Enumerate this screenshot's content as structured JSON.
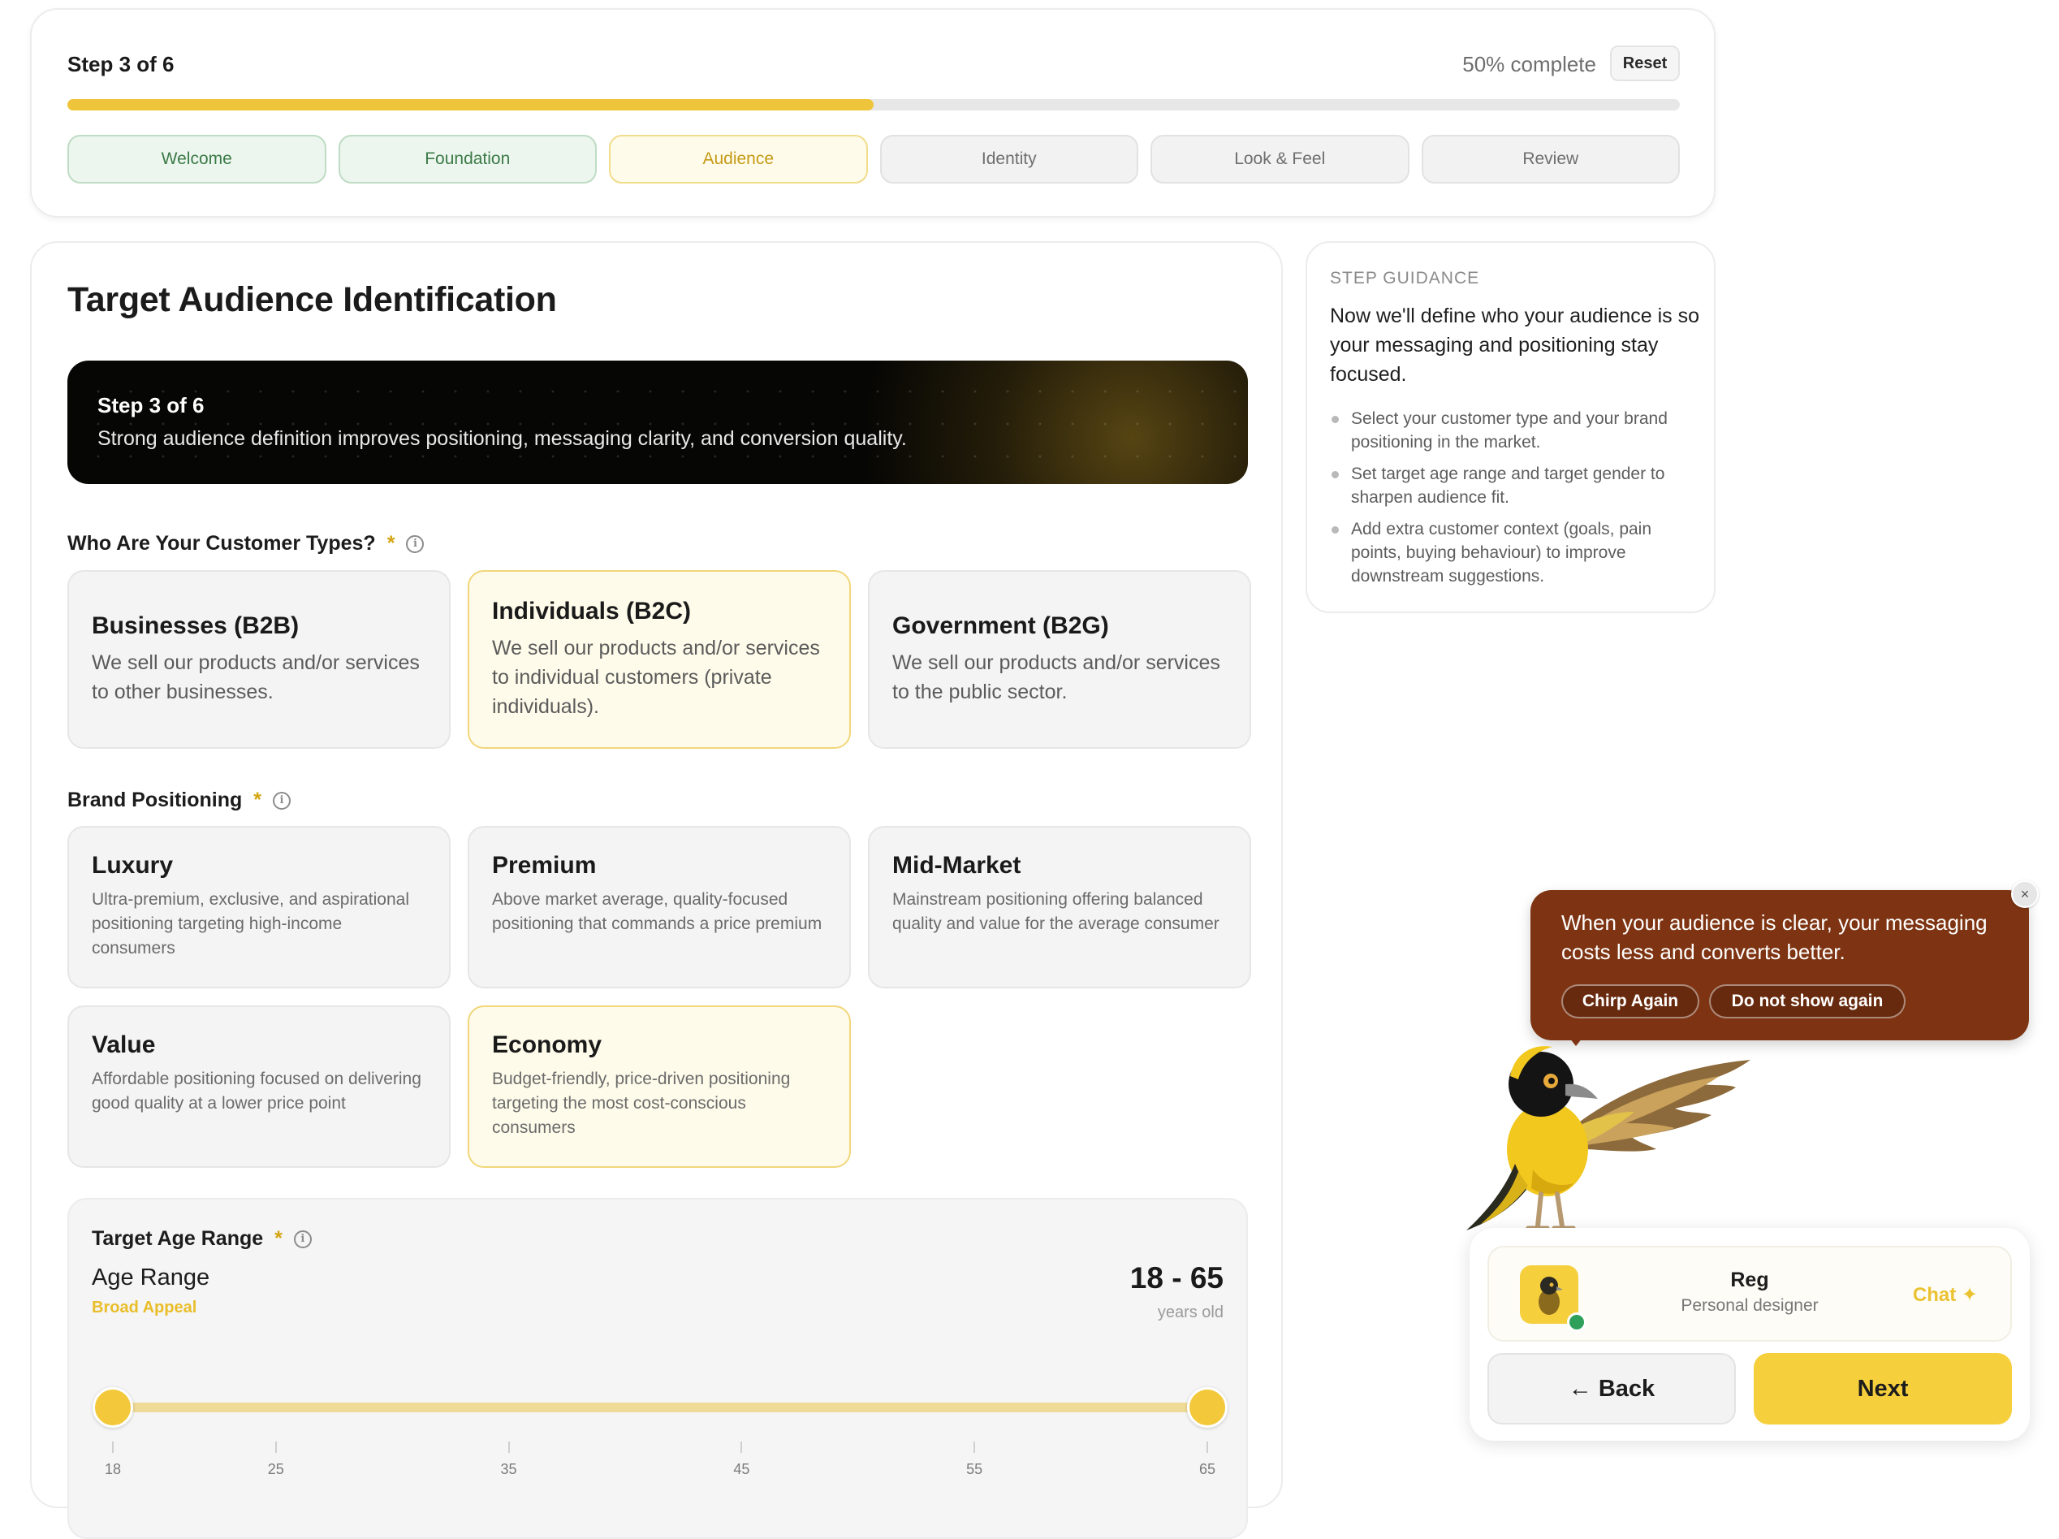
{
  "progress": {
    "step_label": "Step 3 of 6",
    "percent_label": "50% complete",
    "percent": 50,
    "reset_label": "Reset",
    "steps": [
      {
        "label": "Welcome",
        "state": "done"
      },
      {
        "label": "Foundation",
        "state": "done"
      },
      {
        "label": "Audience",
        "state": "current"
      },
      {
        "label": "Identity",
        "state": "todo"
      },
      {
        "label": "Look & Feel",
        "state": "todo"
      },
      {
        "label": "Review",
        "state": "todo"
      }
    ]
  },
  "main": {
    "title": "Target Audience Identification",
    "banner": {
      "title": "Step 3 of 6",
      "text": "Strong audience definition improves positioning, messaging clarity, and conversion quality."
    },
    "customer_types": {
      "label": "Who Are Your Customer Types?",
      "required_mark": "*",
      "options": [
        {
          "title": "Businesses (B2B)",
          "desc": "We sell our products and/or services to other businesses.",
          "selected": false
        },
        {
          "title": "Individuals (B2C)",
          "desc": "We sell our products and/or services to individual customers (private individuals).",
          "selected": true
        },
        {
          "title": "Government (B2G)",
          "desc": "We sell our products and/or services to the public sector.",
          "selected": false
        }
      ]
    },
    "brand_positioning": {
      "label": "Brand Positioning",
      "required_mark": "*",
      "options": [
        {
          "title": "Luxury",
          "desc": "Ultra-premium, exclusive, and aspirational positioning targeting high-income consumers",
          "selected": false
        },
        {
          "title": "Premium",
          "desc": "Above market average, quality-focused positioning that commands a price premium",
          "selected": false
        },
        {
          "title": "Mid-Market",
          "desc": "Mainstream positioning offering balanced quality and value for the average consumer",
          "selected": false
        },
        {
          "title": "Value",
          "desc": "Affordable positioning focused on delivering good quality at a lower price point",
          "selected": false
        },
        {
          "title": "Economy",
          "desc": "Budget-friendly, price-driven positioning targeting the most cost-conscious consumers",
          "selected": true
        }
      ]
    },
    "age_range": {
      "label": "Target Age Range",
      "required_mark": "*",
      "field_label": "Age Range",
      "sub_label": "Broad Appeal",
      "value_text": "18 - 65",
      "unit": "years old",
      "min": 18,
      "max": 65,
      "low": 18,
      "high": 65,
      "ticks": [
        "18",
        "25",
        "35",
        "45",
        "55",
        "65"
      ]
    }
  },
  "guidance": {
    "heading": "STEP GUIDANCE",
    "intro": "Now we'll define who your audience is so your messaging and positioning stay focused.",
    "items": [
      "Select your customer type and your brand positioning in the market.",
      "Set target age range and target gender to sharpen audience fit.",
      "Add extra customer context (goals, pain points, buying behaviour) to improve downstream suggestions."
    ]
  },
  "chirp": {
    "message": "When your audience is clear, your messaging costs less and converts better.",
    "again_label": "Chirp Again",
    "dismiss_label": "Do not show again",
    "close_glyph": "×"
  },
  "assistant": {
    "name": "Reg",
    "role": "Personal designer",
    "chat_label": "Chat ✦",
    "back_label": "← Back",
    "next_label": "Next"
  },
  "colors": {
    "accent": "#f6cf3d",
    "progress": "#eec53a",
    "done_green": "#3c7a47",
    "bubble": "#7e3412",
    "online": "#2ea05a"
  },
  "icons": [
    "info-icon",
    "close-icon",
    "bird-illustration",
    "sparkle-icon",
    "arrow-left-icon"
  ]
}
